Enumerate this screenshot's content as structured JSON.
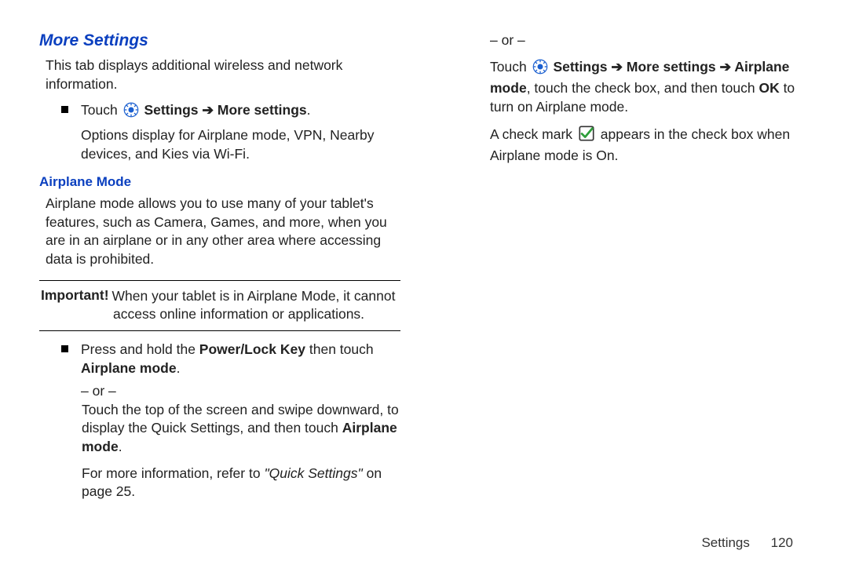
{
  "headings": {
    "more_settings": "More Settings",
    "airplane_mode": "Airplane Mode"
  },
  "left": {
    "intro": "This tab displays additional wireless and network information.",
    "touch_word": "Touch",
    "settings_path": "Settings ➔ More settings",
    "period": ".",
    "options_line": "Options display for Airplane mode, VPN, Nearby devices, and Kies via Wi-Fi.",
    "airplane_desc": "Airplane mode allows you to use many of your tablet's features, such as Camera, Games, and more, when you are in an airplane or in any other area where accessing data is prohibited.",
    "important_label": "Important!",
    "important_line1": "When your tablet is in Airplane Mode, it cannot",
    "important_line2": "access online information or applications.",
    "press_hold_a": "Press and hold the ",
    "power_lock": "Power/Lock Key",
    "press_hold_b": " then touch ",
    "airplane_mode_bold": "Airplane mode",
    "or": "– or –"
  },
  "right": {
    "swipe_a": "Touch the top of the screen and swipe downward, to display the Quick Settings, and then touch ",
    "airplane_mode_bold2": "Airplane mode",
    "for_more_a": "For more information, refer to ",
    "quick_settings_ref": "\"Quick Settings\"",
    "for_more_b": " on page 25.",
    "or2": "– or –",
    "touch2": "Touch",
    "path2": "Settings ➔ More settings ➔ Airplane mode",
    "touch2_tail": ", touch the check box, and then touch ",
    "ok": "OK",
    "touch2_end": " to turn on Airplane mode.",
    "check_a": "A check mark ",
    "check_b": " appears in the check box when Airplane mode is On."
  },
  "footer": {
    "section": "Settings",
    "page": "120"
  }
}
